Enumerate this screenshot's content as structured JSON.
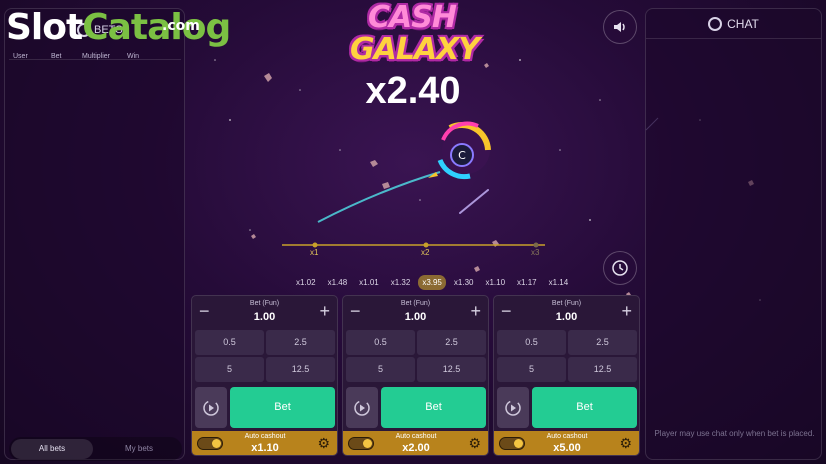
{
  "watermark": {
    "part1": "Slot",
    "part2": "Catalog",
    "suffix": ".com"
  },
  "left_panel": {
    "title": "BETS",
    "columns": [
      "User",
      "Bet",
      "Multiplier",
      "Win"
    ],
    "tabs": [
      {
        "label": "All bets",
        "active": true
      },
      {
        "label": "My bets",
        "active": false
      }
    ]
  },
  "right_panel": {
    "title": "CHAT",
    "note": "Player may use chat only when bet is placed."
  },
  "game": {
    "title_line1": "CASH",
    "title_line2": "GALAXY",
    "multiplier": "x2.40",
    "track_labels": [
      "x1",
      "x2",
      "x3"
    ],
    "history": [
      "x1.02",
      "x1.48",
      "x1.01",
      "x1.32",
      "x3.95",
      "x1.30",
      "x1.10",
      "x1.17",
      "x1.14"
    ],
    "history_highlight_index": 4
  },
  "icons": {
    "sound": "speaker-icon",
    "history": "clock-icon",
    "chat_logo": "ring-logo-icon"
  },
  "colors": {
    "bet_button": "#23cc93",
    "cashout_bar": "#b8831c",
    "history_highlight": "#8b6a33"
  },
  "bet_panels": [
    {
      "label": "Bet (Fun)",
      "amount": "1.00",
      "quick": [
        "0.5",
        "2.5",
        "5",
        "12.5"
      ],
      "bet_label": "Bet",
      "cashout_label": "Auto cashout",
      "cashout_value": "x1.10"
    },
    {
      "label": "Bet (Fun)",
      "amount": "1.00",
      "quick": [
        "0.5",
        "2.5",
        "5",
        "12.5"
      ],
      "bet_label": "Bet",
      "cashout_label": "Auto cashout",
      "cashout_value": "x2.00"
    },
    {
      "label": "Bet (Fun)",
      "amount": "1.00",
      "quick": [
        "0.5",
        "2.5",
        "5",
        "12.5"
      ],
      "bet_label": "Bet",
      "cashout_label": "Auto cashout",
      "cashout_value": "x5.00"
    }
  ]
}
